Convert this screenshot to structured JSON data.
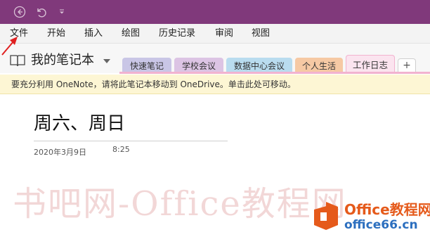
{
  "menu": {
    "items": [
      "文件",
      "开始",
      "插入",
      "绘图",
      "历史记录",
      "审阅",
      "视图"
    ]
  },
  "notebook": {
    "title": "我的笔记本"
  },
  "sections": [
    {
      "label": "快速笔记",
      "color": "#c9c6e6"
    },
    {
      "label": "学校会议",
      "color": "#dcc4e4"
    },
    {
      "label": "数据中心会议",
      "color": "#b9dcef"
    },
    {
      "label": "个人生活",
      "color": "#f6c9a4"
    },
    {
      "label": "工作日志",
      "color": "#fbe4ef"
    }
  ],
  "info_bar": {
    "message": "要充分利用 OneNote，请将此笔记本移动到 OneDrive。单击此处可移动。"
  },
  "page": {
    "title": "周六、周日",
    "date": "2020年3月9日",
    "time": "8:25"
  },
  "watermark": {
    "text": "书吧网-Office教程网"
  },
  "logo": {
    "top": "Office教程网",
    "bottom": "office66.cn"
  },
  "colors": {
    "title_bar": "#80397b",
    "arrow": "#e02020",
    "logo_orange": "#e55a1b",
    "logo_blue": "#2c6fbf"
  },
  "icons": {
    "back": "back-arrow-icon",
    "undo": "undo-icon",
    "more": "chevron-down-icon",
    "notebook": "book-icon",
    "add": "plus-icon"
  }
}
